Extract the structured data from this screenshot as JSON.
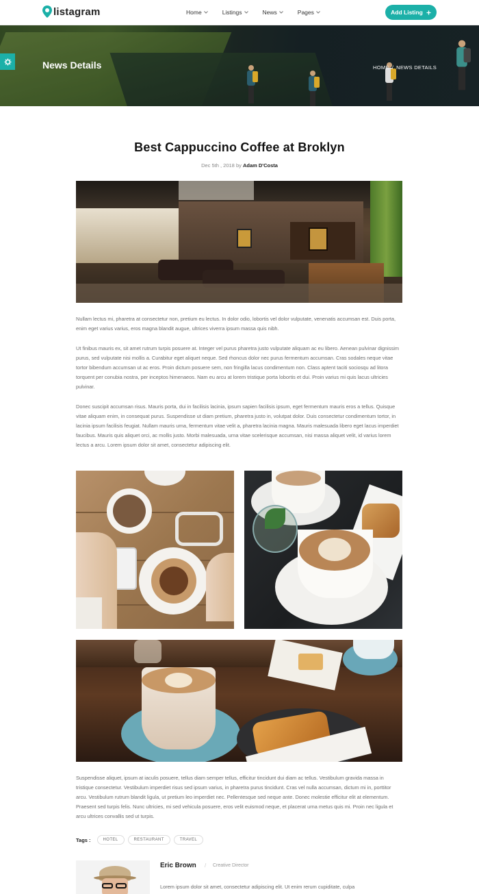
{
  "brand": {
    "name": "listagram",
    "accent": "#1cb0a8"
  },
  "nav": {
    "items": [
      {
        "label": "Home"
      },
      {
        "label": "Listings"
      },
      {
        "label": "News"
      },
      {
        "label": "Pages"
      }
    ],
    "add_listing": "Add Listing"
  },
  "hero": {
    "title": "News Details",
    "breadcrumb": {
      "home": "HOME",
      "separator": "/",
      "current": "NEWS DETAILS"
    }
  },
  "article": {
    "title": "Best Cappuccino Coffee at Broklyn",
    "date": "Dec 5th , 2018",
    "by": "by",
    "author": "Adam D'Costa",
    "paragraphs": [
      "Nullam lectus mi, pharetra at consectetur non, pretium eu lectus. In dolor odio, lobortis vel dolor vulputate, venenatis accumsan est. Duis porta, enim eget varius varius, eros magna blandit augue, ultrices viverra ipsum massa quis nibh.",
      "Ut finibus mauris ex, sit amet rutrum turpis posuere at. Integer vel purus pharetra justo vulputate aliquam ac eu libero. Aenean pulvinar dignissim purus, sed vulputate nisi mollis a. Curabitur eget aliquet neque. Sed rhoncus dolor nec purus fermentum accumsan. Cras sodales neque vitae tortor bibendum accumsan ut ac eros. Proin dictum posuere sem, non fringilla lacus condimentum non. Class aptent taciti sociosqu ad litora torquent per conubia nostra, per inceptos himenaeos. Nam eu arcu at lorem tristique porta lobortis et dui. Proin varius mi quis lacus ultricies pulvinar.",
      "Donec suscipit accumsan risus. Mauris porta, dui in facilisis lacinia, ipsum sapien facilisis ipsum, eget fermentum mauris eros a tellus. Quisque vitae aliquam enim, in consequat purus. Suspendisse ut diam pretium, pharetra justo in, volutpat dolor. Duis consectetur condimentum tortor, in lacinia ipsum facilisis feugiat. Nullam mauris urna, fermentum vitae velit a, pharetra lacinia magna. Mauris malesuada libero eget lacus imperdiet faucibus. Mauris quis aliquet orci, ac mollis justo. Morbi malesuada, urna vitae scelerisque accumsan, nisi massa aliquet velit, id varius lorem lectus a arcu. Lorem ipsum dolor sit amet, consectetur adipiscing elit.",
      "Suspendisse aliquet, ipsum at iaculis posuere, tellus diam semper tellus, efficitur tincidunt dui diam ac tellus. Vestibulum gravida massa in tristique consectetur. Vestibulum imperdiet risus sed ipsum varius, in pharetra purus tincidunt. Cras vel nulla accumsan, dictum mi in, porttitor arcu. Vestibulum rutrum blandit ligula, ut pretium leo imperdiet nec. Pellentesque sed neque ante. Donec molestie efficitur elit at elementum. Praesent sed turpis felis. Nunc ultricies, mi sed vehicula posuere, eros velit euismod neque, et placerat urna metus quis mi. Proin nec ligula et arcu ultrices convallis sed ut turpis."
    ],
    "tags_label": "Tags :",
    "tags": [
      "HOTEL",
      "RESTAURANT",
      "TRAVEL"
    ]
  },
  "author_card": {
    "name": "Eric Brown",
    "separator": "/",
    "role": "Creative Director",
    "bio": "Lorem ipsum dolor sit amet, consectetur adipiscing elit. Ut enim rerum cupiditate, culpa"
  }
}
